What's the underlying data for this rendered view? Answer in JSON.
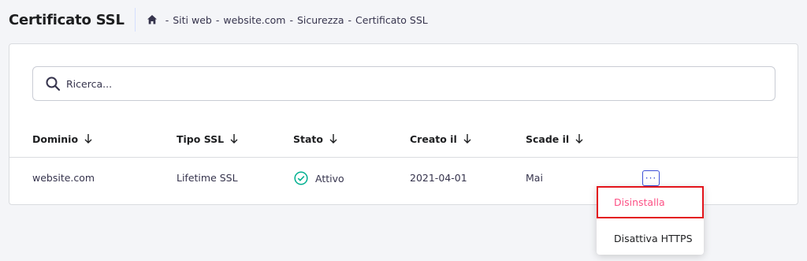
{
  "header": {
    "title": "Certificato SSL",
    "breadcrumb": [
      "Siti web",
      "website.com",
      "Sicurezza",
      "Certificato SSL"
    ],
    "separator": "-"
  },
  "search": {
    "placeholder": "Ricerca..."
  },
  "table": {
    "columns": [
      "Dominio",
      "Tipo SSL",
      "Stato",
      "Creato il",
      "Scade il"
    ],
    "rows": [
      {
        "domain": "website.com",
        "ssl_type": "Lifetime SSL",
        "status": "Attivo",
        "created": "2021-04-01",
        "expires": "Mai"
      }
    ]
  },
  "actions_menu": {
    "button_label": "···",
    "items": [
      "Disinstalla",
      "Disattiva HTTPS"
    ]
  },
  "colors": {
    "accent": "#3d4fd6",
    "success": "#00b090",
    "danger_text": "#fc5185",
    "highlight": "#e3141b"
  },
  "icons": {
    "home": "home-icon",
    "search": "search-icon",
    "sort": "arrow-down-icon",
    "status": "check-circle-icon"
  }
}
